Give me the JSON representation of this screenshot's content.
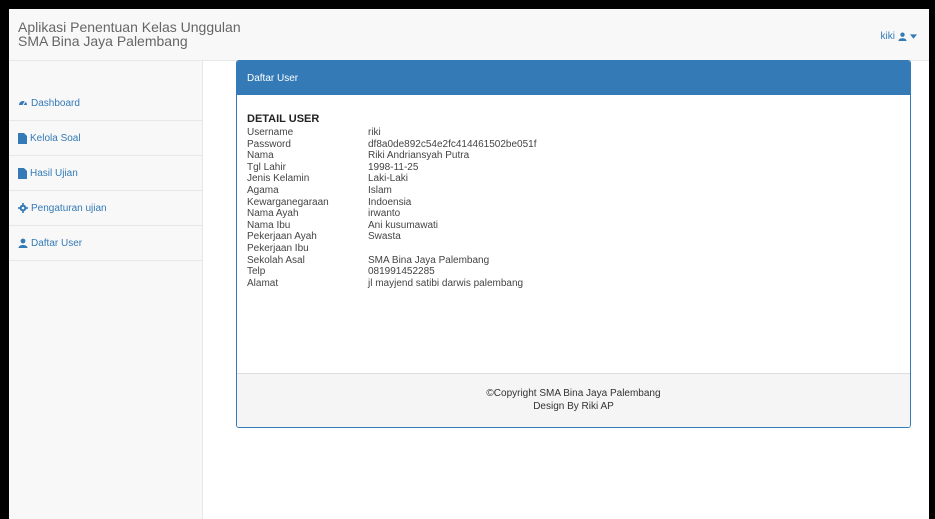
{
  "header": {
    "title_line1": "Aplikasi Penentuan Kelas Unggulan",
    "title_line2": "SMA Bina Jaya Palembang",
    "user_name": "kiki"
  },
  "sidebar": {
    "items": [
      {
        "label": "Dashboard",
        "icon": "dashboard-icon"
      },
      {
        "label": "Kelola Soal",
        "icon": "file-icon"
      },
      {
        "label": "Hasil Ujian",
        "icon": "file-icon"
      },
      {
        "label": "Pengaturan ujian",
        "icon": "gear-icon"
      },
      {
        "label": "Daftar User",
        "icon": "user-icon"
      }
    ]
  },
  "panel": {
    "heading": "Daftar User",
    "detail_title": "DETAIL USER",
    "fields": [
      {
        "label": "Username",
        "value": "riki"
      },
      {
        "label": "Password",
        "value": "df8a0de892c54e2fc414461502be051f"
      },
      {
        "label": "Nama",
        "value": "Riki Andriansyah Putra"
      },
      {
        "label": "Tgl Lahir",
        "value": "1998-11-25"
      },
      {
        "label": "Jenis Kelamin",
        "value": "Laki-Laki"
      },
      {
        "label": "Agama",
        "value": "Islam"
      },
      {
        "label": "Kewarganegaraan",
        "value": "Indoensia"
      },
      {
        "label": "Nama Ayah",
        "value": "irwanto"
      },
      {
        "label": "Nama Ibu",
        "value": "Ani kusumawati"
      },
      {
        "label": "Pekerjaan Ayah",
        "value": "Swasta"
      },
      {
        "label": "Pekerjaan Ibu",
        "value": ""
      },
      {
        "label": "Sekolah Asal",
        "value": "SMA Bina Jaya Palembang"
      },
      {
        "label": "Telp",
        "value": "081991452285"
      },
      {
        "label": "Alamat",
        "value": "jl mayjend satibi darwis palembang"
      }
    ],
    "footer_line1": "©Copyright SMA Bina Jaya Palembang",
    "footer_line2": "Design By Riki AP"
  },
  "colors": {
    "primary": "#337ab7",
    "sidebar_bg": "#f8f8f8",
    "footer_bg": "#f5f5f5"
  }
}
